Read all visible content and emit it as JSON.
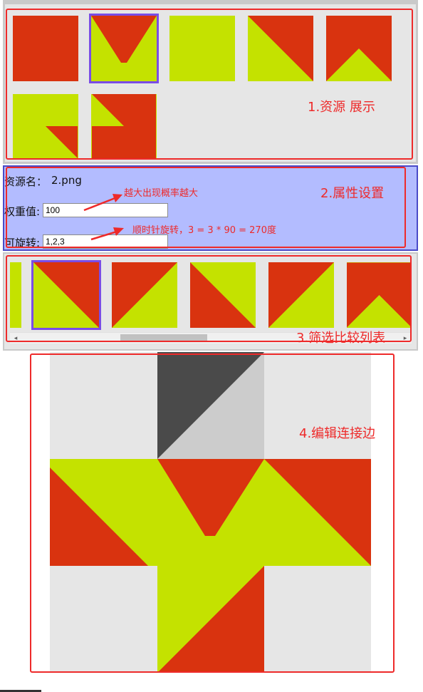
{
  "colors": {
    "red": "#d9330f",
    "yellow": "#c4e200",
    "selected": "#7a4ce6",
    "annotation": "#ee2a2a",
    "props_bg": "#b3bcff",
    "panel_bg": "#e6e6e6",
    "dark_gray": "#4a4a4a",
    "light_gray": "#cccccc"
  },
  "resources": {
    "tiles": [
      {
        "name": "tile-1",
        "pattern": "solid-red"
      },
      {
        "name": "tile-2",
        "pattern": "v-notch",
        "selected": true
      },
      {
        "name": "tile-3",
        "pattern": "solid-yellow"
      },
      {
        "name": "tile-4",
        "pattern": "diag-red-top-right"
      },
      {
        "name": "tile-5",
        "pattern": "peak"
      },
      {
        "name": "tile-6",
        "pattern": "corner-red-bottom-right"
      },
      {
        "name": "tile-7",
        "pattern": "arrow-notch"
      }
    ]
  },
  "properties": {
    "resource_name_label": "资源名：",
    "resource_name_value": "2.png",
    "weight_label": "权重值:",
    "weight_value": "100",
    "rotation_label": "可旋转:",
    "rotation_value": "1,2,3"
  },
  "filter_list": {
    "tiles": [
      {
        "name": "filter-tile-1",
        "pattern": "diag-red-top-right",
        "selected": true
      },
      {
        "name": "filter-tile-2",
        "pattern": "diag-yellow-top-right"
      },
      {
        "name": "filter-tile-3",
        "pattern": "diag-red-top-left"
      },
      {
        "name": "filter-tile-4",
        "pattern": "diag-yellow-left"
      },
      {
        "name": "filter-tile-5",
        "pattern": "peak"
      }
    ],
    "scroll_left_arrow": "◂",
    "scroll_right_arrow": "▸"
  },
  "annotations": {
    "section1": "1.资源 展示",
    "section2": "2.属性设置",
    "section3": "3.筛选比较列表",
    "section4": "4.编辑连接边",
    "weight_note": "越大出现概率越大",
    "rotation_note": "顺时针旋转，3 = 3 * 90 = 270度"
  }
}
